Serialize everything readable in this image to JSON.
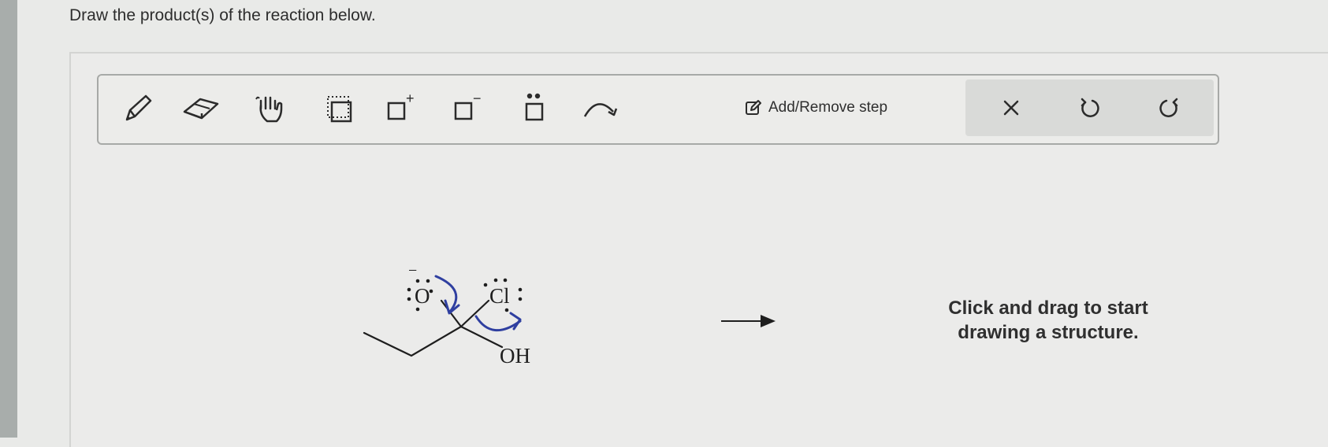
{
  "question": "Draw the product(s) of the reaction below.",
  "toolbar": {
    "tools": [
      {
        "icon": "pencil-icon"
      },
      {
        "icon": "eraser-icon"
      },
      {
        "icon": "hand-icon"
      },
      {
        "icon": "selection-box-icon"
      },
      {
        "icon": "positive-charge-icon",
        "symbol": "+"
      },
      {
        "icon": "negative-charge-icon",
        "symbol": "−"
      },
      {
        "icon": "lone-pair-icon"
      },
      {
        "icon": "curved-arrow-icon"
      }
    ],
    "add_remove_step_label": "Add/Remove step",
    "actions": [
      {
        "icon": "clear-icon",
        "symbol": "×"
      },
      {
        "icon": "undo-icon"
      },
      {
        "icon": "redo-icon"
      }
    ]
  },
  "reaction": {
    "oxygen_label": "O",
    "oxygen_charge": "−",
    "chlorine_label": "Cl",
    "hydroxyl_label": "OH",
    "arrow_color": "#2f3fa0"
  },
  "canvas_hint": "Click and drag to start drawing a structure."
}
